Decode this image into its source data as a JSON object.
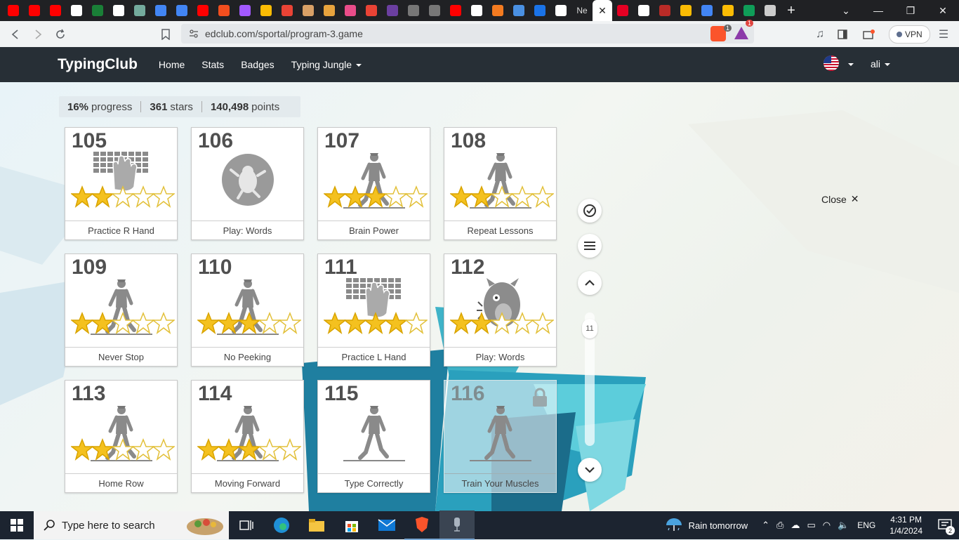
{
  "browser": {
    "tabs": [
      {
        "icon": "youtube-icon",
        "color": "#ff0000"
      },
      {
        "icon": "youtube-icon",
        "color": "#ff0000"
      },
      {
        "icon": "youtube-icon",
        "color": "#ff0000"
      },
      {
        "icon": "app-icon",
        "color": "#ffffff"
      },
      {
        "icon": "app-icon",
        "color": "#1a7f37"
      },
      {
        "icon": "google-icon",
        "color": "#ffffff"
      },
      {
        "icon": "chatgpt-icon",
        "color": "#74aa9c"
      },
      {
        "icon": "docs-icon",
        "color": "#4285f4"
      },
      {
        "icon": "docs-icon",
        "color": "#4285f4"
      },
      {
        "icon": "youtube-icon",
        "color": "#ff0000"
      },
      {
        "icon": "figma-icon",
        "color": "#f24e1e"
      },
      {
        "icon": "figma-icon",
        "color": "#a259ff"
      },
      {
        "icon": "drive-icon",
        "color": "#fbbc04"
      },
      {
        "icon": "app-icon",
        "color": "#ea4335"
      },
      {
        "icon": "portrait-icon",
        "color": "#d9a066"
      },
      {
        "icon": "burger-icon",
        "color": "#e8a33d"
      },
      {
        "icon": "dribbble-icon",
        "color": "#ea4c89"
      },
      {
        "icon": "gmail-icon",
        "color": "#ea4335"
      },
      {
        "icon": "coloris-icon",
        "color": "#6b3fa0"
      },
      {
        "icon": "circle-icon",
        "color": "#777777"
      },
      {
        "icon": "circle-icon",
        "color": "#777777"
      },
      {
        "icon": "youtube-icon",
        "color": "#ff0000"
      },
      {
        "icon": "app-icon",
        "color": "#ffffff"
      },
      {
        "icon": "app-icon",
        "color": "#f47b20"
      },
      {
        "icon": "database-icon",
        "color": "#4a90e2"
      },
      {
        "icon": "share-icon",
        "color": "#1a73e8"
      },
      {
        "icon": "medium-icon",
        "color": "#ffffff"
      }
    ],
    "active_tab_label": "Ne",
    "active_tab_close": "✕",
    "tabs_after": [
      {
        "icon": "pinterest-icon",
        "color": "#e60023"
      },
      {
        "icon": "google-icon",
        "color": "#ffffff"
      },
      {
        "icon": "quora-icon",
        "color": "#b92b27"
      },
      {
        "icon": "drive-icon",
        "color": "#fbbc04"
      },
      {
        "icon": "docs-icon",
        "color": "#4285f4"
      },
      {
        "icon": "drive-icon",
        "color": "#fbbc04"
      },
      {
        "icon": "sheets-icon",
        "color": "#0f9d58"
      },
      {
        "icon": "bank-icon",
        "color": "#cccccc"
      }
    ],
    "new_tab": "+",
    "url": "edclub.com/sportal/program-3.game",
    "vpn_label": "VPN",
    "shield_badge": "1",
    "alert_badge": "1"
  },
  "site": {
    "brand": "TypingClub",
    "nav": [
      "Home",
      "Stats",
      "Badges",
      "Typing Jungle"
    ],
    "user": "ali"
  },
  "progress": {
    "percent": "16%",
    "percent_label": "progress",
    "stars": "361",
    "stars_label": "stars",
    "points": "140,498",
    "points_label": "points"
  },
  "lessons": [
    {
      "num": "105",
      "label": "Practice R Hand",
      "art": "keyboard-hand-icon",
      "stars_filled": 2,
      "stars_total": 5,
      "locked": false
    },
    {
      "num": "106",
      "label": "Play: Words",
      "art": "game-icon",
      "stars_filled": 0,
      "stars_total": 0,
      "locked": false
    },
    {
      "num": "107",
      "label": "Brain Power",
      "art": "walking-man-icon",
      "stars_filled": 3,
      "stars_total": 5,
      "locked": false
    },
    {
      "num": "108",
      "label": "Repeat Lessons",
      "art": "walking-man-icon",
      "stars_filled": 2,
      "stars_total": 5,
      "locked": false
    },
    {
      "num": "109",
      "label": "Never Stop",
      "art": "walking-man-icon",
      "stars_filled": 2,
      "stars_total": 5,
      "locked": false
    },
    {
      "num": "110",
      "label": "No Peeking",
      "art": "walking-man-icon",
      "stars_filled": 3,
      "stars_total": 5,
      "locked": false
    },
    {
      "num": "111",
      "label": "Practice L Hand",
      "art": "keyboard-hand-icon",
      "stars_filled": 4,
      "stars_total": 5,
      "locked": false
    },
    {
      "num": "112",
      "label": "Play: Words",
      "art": "monster-icon",
      "stars_filled": 2,
      "stars_total": 5,
      "locked": false
    },
    {
      "num": "113",
      "label": "Home Row",
      "art": "walking-man-icon",
      "stars_filled": 2,
      "stars_total": 5,
      "locked": false
    },
    {
      "num": "114",
      "label": "Moving Forward",
      "art": "walking-man-icon",
      "stars_filled": 3,
      "stars_total": 5,
      "locked": false
    },
    {
      "num": "115",
      "label": "Type Correctly",
      "art": "walking-man-icon",
      "stars_filled": 0,
      "stars_total": 0,
      "locked": false
    },
    {
      "num": "116",
      "label": "Train Your Muscles",
      "art": "walking-man-icon",
      "stars_filled": 0,
      "stars_total": 0,
      "locked": true
    }
  ],
  "sidebar": {
    "scroll_pill": "11",
    "close_label": "Close",
    "close_icon": "✕"
  },
  "taskbar": {
    "search_placeholder": "Type here to search",
    "weather": "Rain tomorrow",
    "lang": "ENG",
    "time": "4:31 PM",
    "date": "1/4/2024",
    "notif_count": "2"
  }
}
